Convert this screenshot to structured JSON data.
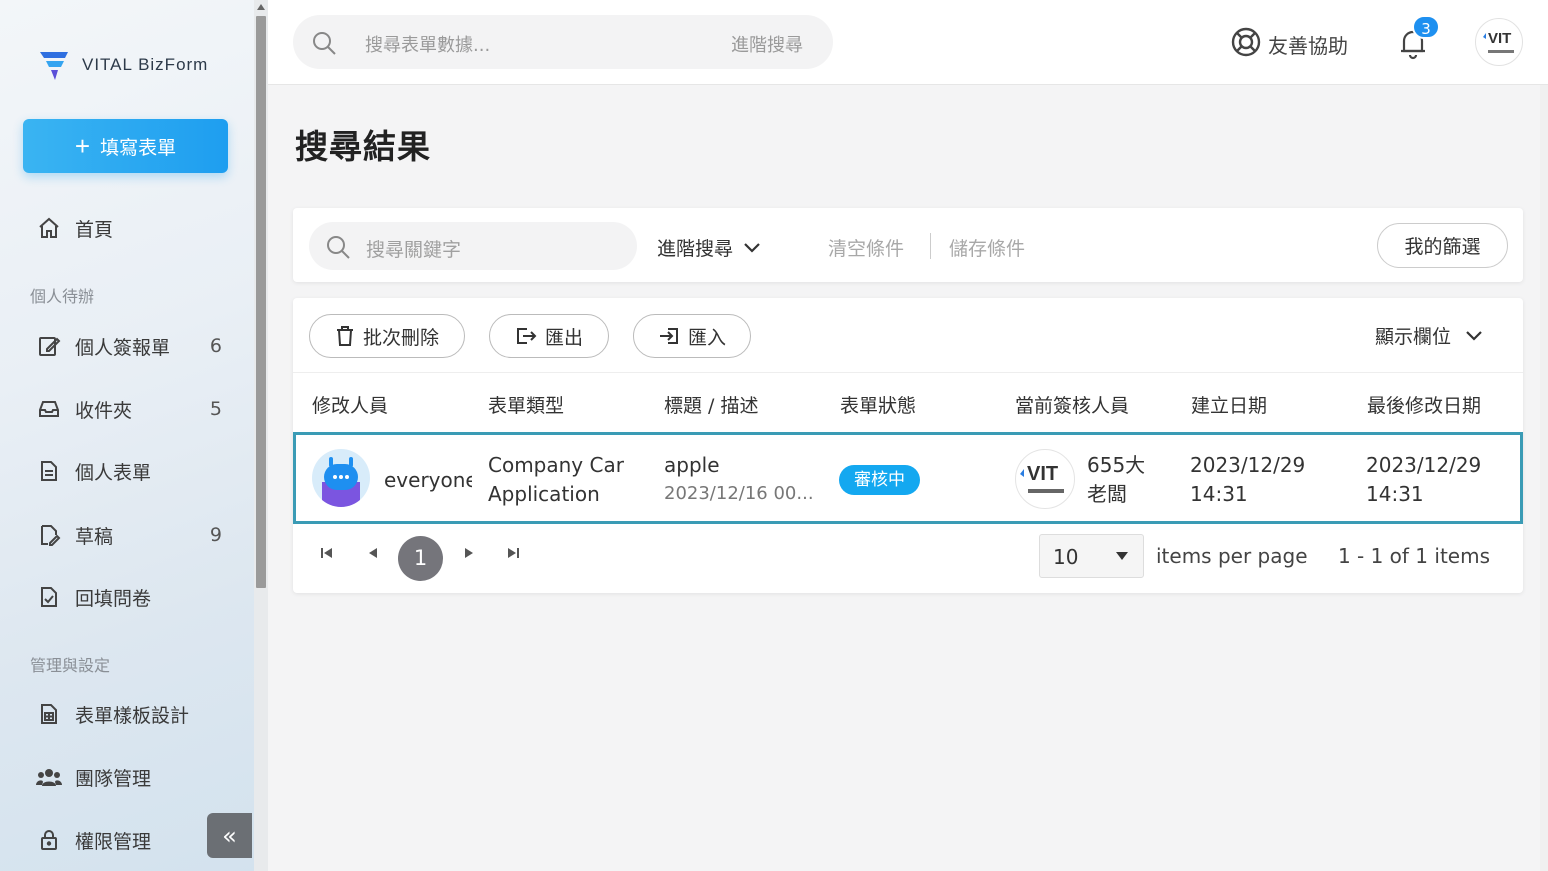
{
  "brand": {
    "name": "VITAL BizForm"
  },
  "sidebar": {
    "fill_button": "填寫表單",
    "home": "首頁",
    "section_personal": "個人待辦",
    "items": [
      {
        "label": "個人簽報單",
        "count": "6"
      },
      {
        "label": "收件夾",
        "count": "5"
      },
      {
        "label": "個人表單",
        "count": ""
      },
      {
        "label": "草稿",
        "count": "9"
      },
      {
        "label": "回填問卷",
        "count": ""
      }
    ],
    "section_admin": "管理與設定",
    "admin_items": [
      {
        "label": "表單樣板設計"
      },
      {
        "label": "團隊管理"
      },
      {
        "label": "權限管理"
      }
    ],
    "collapse": "«"
  },
  "topbar": {
    "search_placeholder": "搜尋表單數據...",
    "advanced": "進階搜尋",
    "help": "友善協助",
    "notification_count": "3",
    "avatar_text": "VIT"
  },
  "page": {
    "title": "搜尋結果"
  },
  "filter": {
    "keyword_placeholder": "搜尋關鍵字",
    "advanced": "進階搜尋",
    "clear": "清空條件",
    "save": "儲存條件",
    "my_filter": "我的篩選"
  },
  "toolbar": {
    "batch_delete": "批次刪除",
    "export": "匯出",
    "import": "匯入",
    "show_columns": "顯示欄位"
  },
  "table": {
    "headers": [
      "修改人員",
      "表單類型",
      "標題 / 描述",
      "表單狀態",
      "當前簽核人員",
      "建立日期",
      "最後修改日期"
    ],
    "rows": [
      {
        "modifier": "everyone",
        "form_type_1": "Company Car",
        "form_type_2": "Application",
        "title": "apple",
        "description": "2023/12/16 00...",
        "status": "審核中",
        "approver_logo": "VIT",
        "approver_1": "655大",
        "approver_2": "老闆",
        "created_date": "2023/12/29",
        "created_time": "14:31",
        "modified_date": "2023/12/29",
        "modified_time": "14:31"
      }
    ]
  },
  "pagination": {
    "current": "1",
    "page_size": "10",
    "items_per_page": "items per page",
    "range": "1 - 1 of 1 items"
  },
  "colors": {
    "accent": "#1e9ef0",
    "status": "#14a8f0",
    "row_border": "#3a9bb5"
  }
}
